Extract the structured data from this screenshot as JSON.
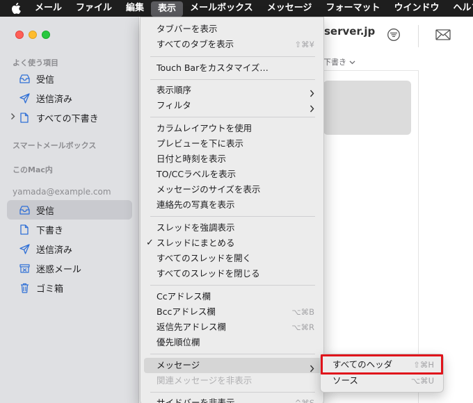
{
  "menubar": {
    "items": [
      "メール",
      "ファイル",
      "編集",
      "表示",
      "メールボックス",
      "メッセージ",
      "フォーマット",
      "ウインドウ",
      "ヘルプ"
    ],
    "active_index": 3
  },
  "toolbar": {
    "title": "server.jp"
  },
  "sortbar": {
    "label": "下書き"
  },
  "sidebar": {
    "favorites_heading": "よく使う項目",
    "favorites": [
      {
        "label": "受信",
        "icon": "inbox-icon"
      },
      {
        "label": "送信済み",
        "icon": "sent-icon"
      },
      {
        "label": "すべての下書き",
        "icon": "document-icon"
      }
    ],
    "smart_heading": "スマートメールボックス",
    "mac_heading": "このMac内",
    "account_heading": "yamada@example.com",
    "account_items": [
      {
        "label": "受信",
        "icon": "inbox-icon"
      },
      {
        "label": "下書き",
        "icon": "document-icon"
      },
      {
        "label": "送信済み",
        "icon": "sent-icon"
      },
      {
        "label": "迷惑メール",
        "icon": "junk-icon"
      },
      {
        "label": "ゴミ箱",
        "icon": "trash-icon"
      }
    ]
  },
  "view_menu": {
    "items": [
      {
        "label": "タブバーを表示",
        "shortcut": ""
      },
      {
        "label": "すべてのタブを表示",
        "shortcut": "⇧⌘¥"
      },
      {
        "label": "Touch Barをカスタマイズ…",
        "shortcut": ""
      },
      {
        "label": "表示順序",
        "shortcut": ""
      },
      {
        "label": "フィルタ",
        "shortcut": ""
      },
      {
        "label": "カラムレイアウトを使用",
        "shortcut": ""
      },
      {
        "label": "プレビューを下に表示",
        "shortcut": ""
      },
      {
        "label": "日付と時刻を表示",
        "shortcut": ""
      },
      {
        "label": "TO/CCラベルを表示",
        "shortcut": ""
      },
      {
        "label": "メッセージのサイズを表示",
        "shortcut": ""
      },
      {
        "label": "連絡先の写真を表示",
        "shortcut": ""
      },
      {
        "label": "スレッドを強調表示",
        "shortcut": ""
      },
      {
        "label": "スレッドにまとめる",
        "shortcut": "",
        "checked": true
      },
      {
        "label": "すべてのスレッドを開く",
        "shortcut": ""
      },
      {
        "label": "すべてのスレッドを閉じる",
        "shortcut": ""
      },
      {
        "label": "Ccアドレス欄",
        "shortcut": ""
      },
      {
        "label": "Bccアドレス欄",
        "shortcut": "⌥⌘B"
      },
      {
        "label": "返信先アドレス欄",
        "shortcut": "⌥⌘R"
      },
      {
        "label": "優先順位欄",
        "shortcut": ""
      },
      {
        "label": "メッセージ",
        "shortcut": "",
        "highlighted": true
      },
      {
        "label": "関連メッセージを非表示",
        "shortcut": "",
        "disabled": true
      },
      {
        "label": "サイドバーを非表示",
        "shortcut": "^⌘S"
      }
    ]
  },
  "message_submenu": {
    "items": [
      {
        "label": "すべてのヘッダ",
        "shortcut": "⇧⌘H"
      },
      {
        "label": "ソース",
        "shortcut": "⌥⌘U"
      }
    ]
  },
  "colors": {
    "highlight_box": "#e0141b",
    "menubar": "#1e1e1e",
    "accent_icon": "#2f6fd6"
  }
}
